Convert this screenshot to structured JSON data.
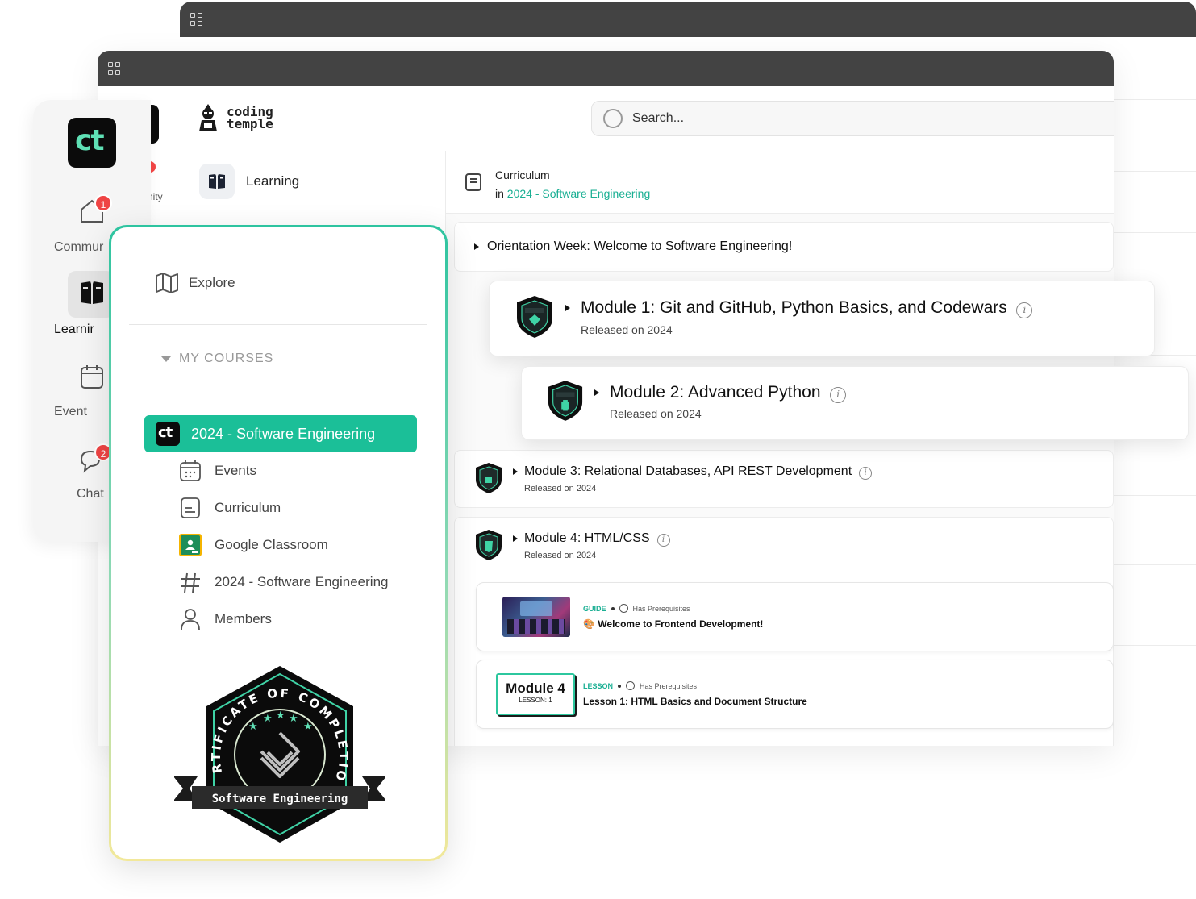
{
  "app": {
    "brand_line1": "coding",
    "brand_line2": "temple",
    "search_placeholder": "Search..."
  },
  "left_column": {
    "section_label": "Learning"
  },
  "rail": {
    "logo_text": "ct",
    "items": [
      {
        "label": "Community",
        "visible_text": "Commur",
        "icon": "home-icon",
        "badge": "1"
      },
      {
        "label": "Learning",
        "visible_text": "Learnir",
        "icon": "book-icon",
        "active": true
      },
      {
        "label": "Events",
        "visible_text": "Event",
        "icon": "calendar-icon"
      },
      {
        "label": "Chat",
        "visible_text": "Chat",
        "icon": "chat-icon",
        "badge": "2"
      }
    ],
    "partial_text": "nity"
  },
  "course_panel": {
    "explore_label": "Explore",
    "my_courses_label": "MY COURSES",
    "active_course": {
      "logo_text": "ct",
      "label": "2024 - Software Engineering"
    },
    "sub_items": [
      {
        "label": "Events",
        "icon": "calendar-icon"
      },
      {
        "label": "Curriculum",
        "icon": "document-icon"
      },
      {
        "label": "Google Classroom",
        "icon": "google-classroom-icon"
      },
      {
        "label": "2024 - Software Engineering",
        "icon": "hash-icon"
      },
      {
        "label": "Members",
        "icon": "user-icon"
      }
    ],
    "certificate": {
      "arc_text": "CERTIFICATE OF COMPLETION",
      "ribbon_text": "Software Engineering",
      "stars": 5
    }
  },
  "breadcrumb": {
    "title": "Curriculum",
    "prefix": "in ",
    "course_link": "2024 - Software Engineering"
  },
  "curriculum": {
    "orientation": "Orientation Week: Welcome to Software Engineering!",
    "modules": [
      {
        "title": "Module 1: Git and GitHub, Python Basics, and Codewars",
        "released": "Released on 2024"
      },
      {
        "title": "Module 2: Advanced Python",
        "released": "Released on 2024"
      },
      {
        "title": "Module 3: Relational Databases, API REST Development",
        "released": "Released on 2024"
      },
      {
        "title": "Module 4: HTML/CSS",
        "released": "Released on 2024"
      }
    ],
    "lessons": [
      {
        "kind": "GUIDE",
        "prereq": "Has Prerequisites",
        "title": "Welcome to Frontend Development!",
        "emoji": "🎨"
      },
      {
        "kind": "LESSON",
        "prereq": "Has Prerequisites",
        "title": "Lesson 1: HTML Basics and Document Structure",
        "thumb_title": "Module 4",
        "thumb_sub": "LESSON: 1"
      }
    ]
  },
  "colors": {
    "accent": "#1bbf98",
    "link": "#1aaf93",
    "titlebar": "#434343",
    "badge": "#ef4444"
  }
}
